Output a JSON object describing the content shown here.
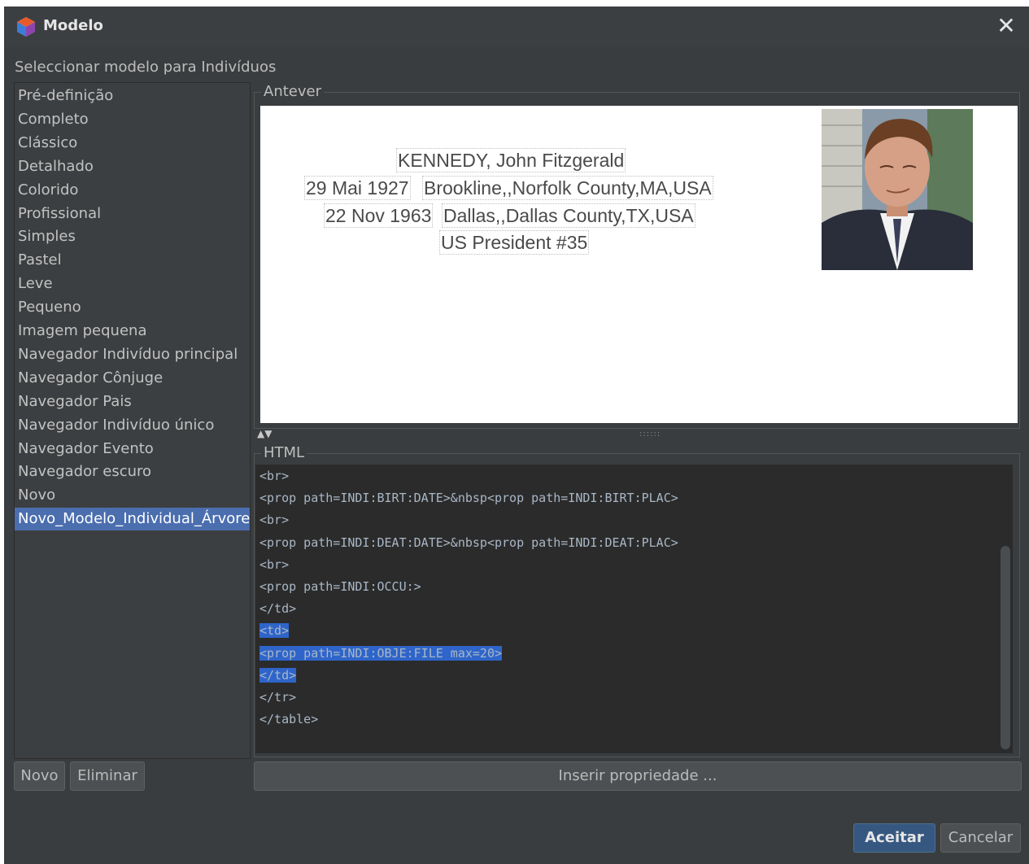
{
  "window": {
    "title": "Modelo",
    "close_symbol": "✕"
  },
  "subtitle": "Seleccionar modelo para Indivíduos",
  "templates": [
    "Pré-definição",
    "Completo",
    "Clássico",
    "Detalhado",
    "Colorido",
    "Profissional",
    "Simples",
    "Pastel",
    "Leve",
    "Pequeno",
    "Imagem pequena",
    "Navegador Indivíduo principal",
    "Navegador Cônjuge",
    "Navegador Pais",
    "Navegador Indivíduo único",
    "Navegador Evento",
    "Navegador escuro",
    "Novo",
    "Novo_Modelo_Individual_Árvore"
  ],
  "selected_template": "Novo_Modelo_Individual_Árvore",
  "list_buttons": {
    "new": "Novo",
    "delete": "Eliminar"
  },
  "preview": {
    "label": "Antever",
    "name": "KENNEDY, John Fitzgerald",
    "birth_date": "29 Mai 1927",
    "birth_place": "Brookline,,Norfolk County,MA,USA",
    "death_date": "22 Nov 1963",
    "death_place": "Dallas,,Dallas County,TX,USA",
    "occupation": "US President #35"
  },
  "splitter": {
    "arrows": "▲▼",
    "grip": "::::::"
  },
  "html_section": {
    "label": "HTML",
    "lines": [
      "<br>",
      "<prop path=INDI:BIRT:DATE>&nbsp<prop path=INDI:BIRT:PLAC>",
      "<br>",
      "<prop path=INDI:DEAT:DATE>&nbsp<prop path=INDI:DEAT:PLAC>",
      "<br>",
      "<prop path=INDI:OCCU:>",
      "</td>",
      "<td>",
      "<prop path=INDI:OBJE:FILE max=20>",
      "</td>",
      "</tr>",
      "</table>"
    ],
    "selected_line_indices": [
      7,
      8,
      9
    ]
  },
  "insert_property_button": "Inserir propriedade ...",
  "dialog_buttons": {
    "ok": "Aceitar",
    "cancel": "Cancelar"
  },
  "colors": {
    "background": "#3a3d3f",
    "selection": "#4b6eaf",
    "primary_button": "#365880",
    "editor_background": "#2b2b2b"
  }
}
